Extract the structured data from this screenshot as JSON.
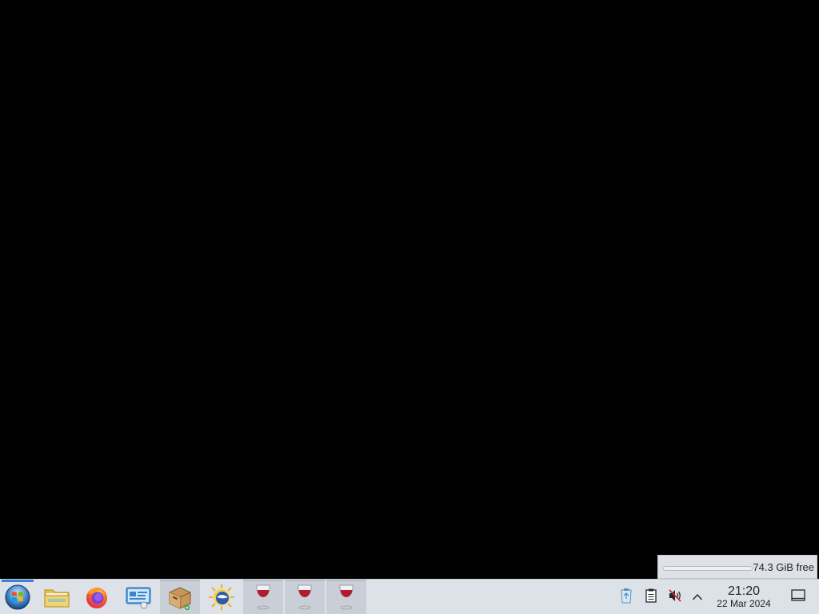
{
  "desktop": {
    "background": "#000000"
  },
  "disk_widget": {
    "label": "74.3 GiB free",
    "used_fraction": 0.0
  },
  "taskbar": {
    "background": "#dde1e8",
    "launchers": [
      {
        "name": "start-menu-button",
        "icon": "windows-logo-icon"
      },
      {
        "name": "file-manager-launcher",
        "icon": "folder-icon"
      },
      {
        "name": "firefox-launcher",
        "icon": "firefox-icon"
      },
      {
        "name": "system-settings-launcher",
        "icon": "control-panel-icon"
      },
      {
        "name": "package-installer-launcher",
        "icon": "package-box-icon"
      },
      {
        "name": "weather-globe-launcher",
        "icon": "globe-sun-icon"
      },
      {
        "name": "wine-app-1",
        "icon": "wine-glass-icon"
      },
      {
        "name": "wine-app-2",
        "icon": "wine-glass-icon"
      },
      {
        "name": "wine-app-3",
        "icon": "wine-glass-icon"
      }
    ],
    "tray": {
      "icons": [
        "clipboard-recycle-icon",
        "notes-icon",
        "volume-muted-icon",
        "chevron-up-icon"
      ]
    },
    "clock": {
      "time": "21:20",
      "date": "22 Mar 2024"
    },
    "show_desktop": {
      "icon": "show-desktop-icon"
    }
  }
}
